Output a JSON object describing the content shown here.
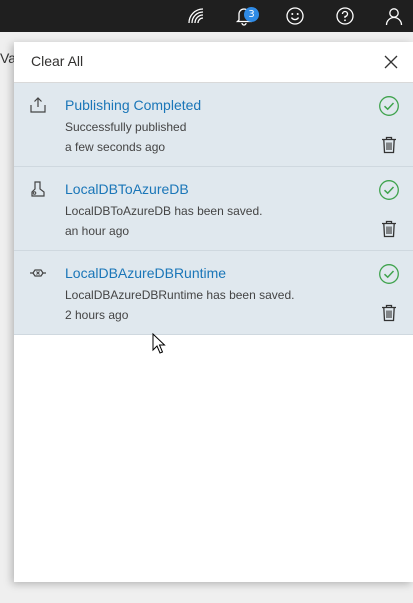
{
  "topbar": {
    "notification_count": "3",
    "icons": [
      "feedback-signal-icon",
      "bell-icon",
      "smiley-icon",
      "help-icon",
      "account-icon"
    ]
  },
  "background": {
    "fragment_text": "Va"
  },
  "panel": {
    "clear_all_label": "Clear All",
    "close_icon": "close-icon",
    "notifications": [
      {
        "icon": "upload-icon",
        "title": "Publishing Completed",
        "message": "Successfully published",
        "time": "a few seconds ago",
        "status_icon": "check-circle-icon"
      },
      {
        "icon": "pipeline-icon",
        "title": "LocalDBToAzureDB",
        "message": "LocalDBToAzureDB has been saved.",
        "time": "an hour ago",
        "status_icon": "check-circle-icon"
      },
      {
        "icon": "runtime-icon",
        "title": "LocalDBAzureDBRuntime",
        "message": "LocalDBAzureDBRuntime has been saved.",
        "time": "2 hours ago",
        "status_icon": "check-circle-icon"
      }
    ]
  },
  "colors": {
    "topbar": "#1f1f1f",
    "badge": "#2f8be6",
    "notification_bg": "#e0e8ee",
    "link": "#1a76b8",
    "success": "#3fa34d"
  }
}
